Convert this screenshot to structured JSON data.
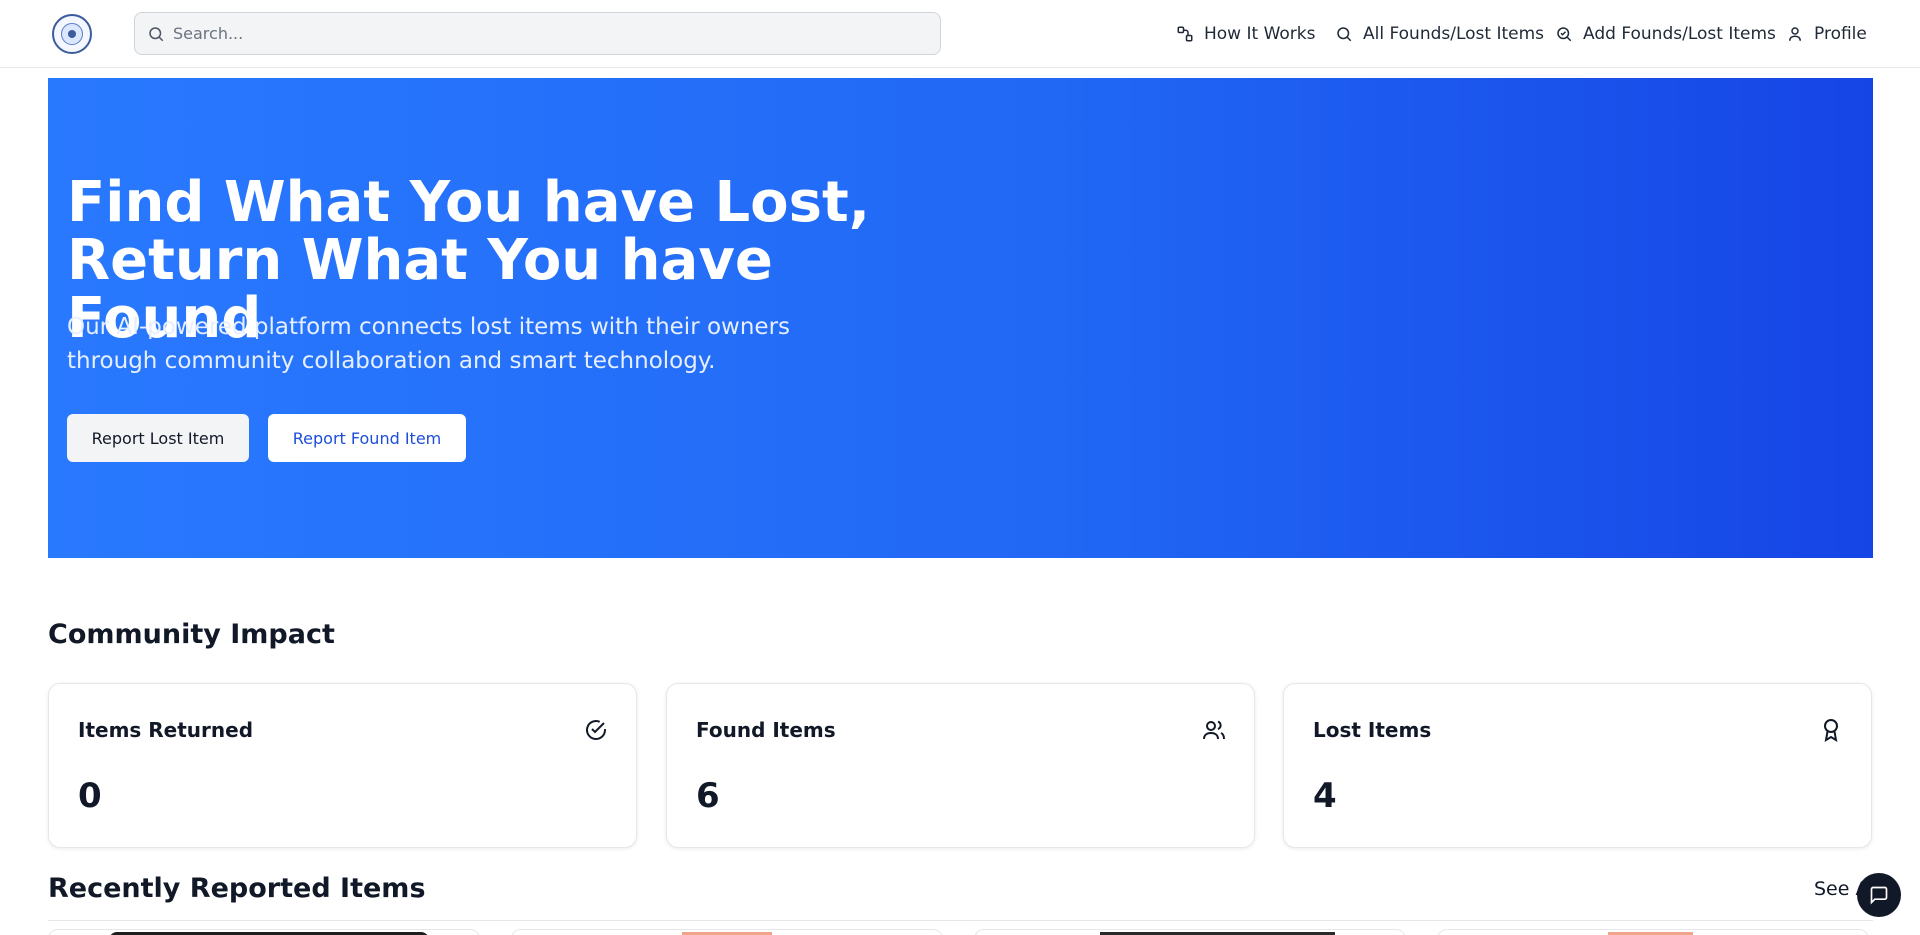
{
  "header": {
    "search_placeholder": "Search...",
    "nav": {
      "how_it_works": "How It Works",
      "all_items": "All Founds/Lost Items",
      "add_items": "Add Founds/Lost Items",
      "profile": "Profile"
    }
  },
  "hero": {
    "title_line1": "Find What You have Lost,",
    "title_line2": "Return What You have Found",
    "subtitle": "Our AI-powered platform connects lost items with their owners through community collaboration and smart technology.",
    "report_lost_label": "Report Lost Item",
    "report_found_label": "Report Found Item"
  },
  "impact": {
    "title": "Community Impact",
    "cards": [
      {
        "label": "Items Returned",
        "value": "0",
        "icon": "check-circle-icon"
      },
      {
        "label": "Found Items",
        "value": "6",
        "icon": "users-icon"
      },
      {
        "label": "Lost Items",
        "value": "4",
        "icon": "award-icon"
      }
    ]
  },
  "recent": {
    "title": "Recently Reported Items",
    "see_all_label": "See All"
  },
  "colors": {
    "hero_start": "#2979ff",
    "hero_end": "#1645e6",
    "accent": "#1d4ed8"
  }
}
